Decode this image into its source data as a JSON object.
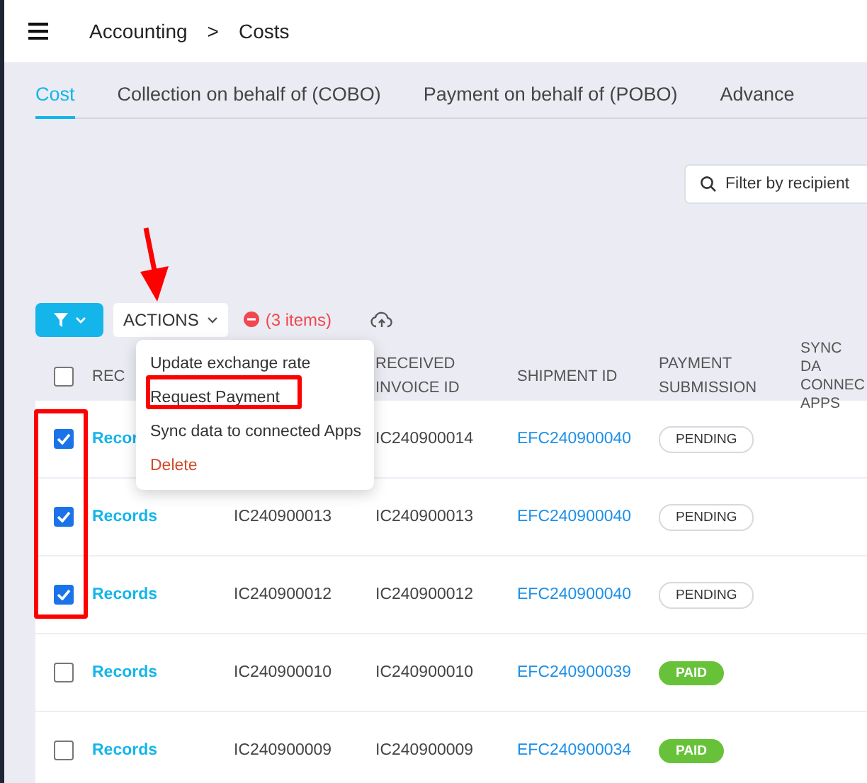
{
  "header": {
    "breadcrumb": [
      "Accounting",
      ">",
      "Costs"
    ]
  },
  "tabs": [
    {
      "label": "Cost",
      "selected": true
    },
    {
      "label": "Collection on behalf of (COBO)",
      "selected": false
    },
    {
      "label": "Payment on behalf of (POBO)",
      "selected": false
    },
    {
      "label": "Advance",
      "selected": false
    }
  ],
  "filter": {
    "placeholder": "Filter by recipient"
  },
  "toolbar": {
    "actions_label": "ACTIONS",
    "selection_count": "(3 items)"
  },
  "actions_menu": {
    "items": [
      {
        "label": "Update exchange rate",
        "kind": "normal"
      },
      {
        "label": "Request Payment",
        "kind": "normal"
      },
      {
        "label": "Sync data to connected Apps",
        "kind": "normal"
      },
      {
        "label": "Delete",
        "kind": "danger"
      }
    ]
  },
  "table": {
    "all_checked": false,
    "columns": [
      "REC",
      "RECEIVED INVOICE ID",
      "SHIPMENT ID",
      "PAYMENT SUBMISSION",
      "SYNC DA CONNEC APPS"
    ],
    "rows": [
      {
        "checked": true,
        "records": "Recor",
        "received_invoice_id": "IC240900014",
        "shipment_id": "EFC240900040",
        "status": {
          "label": "PENDING",
          "kind": "pending"
        }
      },
      {
        "checked": true,
        "records": "Records",
        "invoice_id": "IC240900013",
        "received_invoice_id": "IC240900013",
        "shipment_id": "EFC240900040",
        "status": {
          "label": "PENDING",
          "kind": "pending"
        }
      },
      {
        "checked": true,
        "records": "Records",
        "invoice_id": "IC240900012",
        "received_invoice_id": "IC240900012",
        "shipment_id": "EFC240900040",
        "status": {
          "label": "PENDING",
          "kind": "pending"
        }
      },
      {
        "checked": false,
        "records": "Records",
        "invoice_id": "IC240900010",
        "received_invoice_id": "IC240900010",
        "shipment_id": "EFC240900039",
        "status": {
          "label": "PAID",
          "kind": "paid"
        }
      },
      {
        "checked": false,
        "records": "Records",
        "invoice_id": "IC240900009",
        "received_invoice_id": "IC240900009",
        "shipment_id": "EFC240900034",
        "status": {
          "label": "PAID",
          "kind": "paid"
        }
      }
    ]
  }
}
